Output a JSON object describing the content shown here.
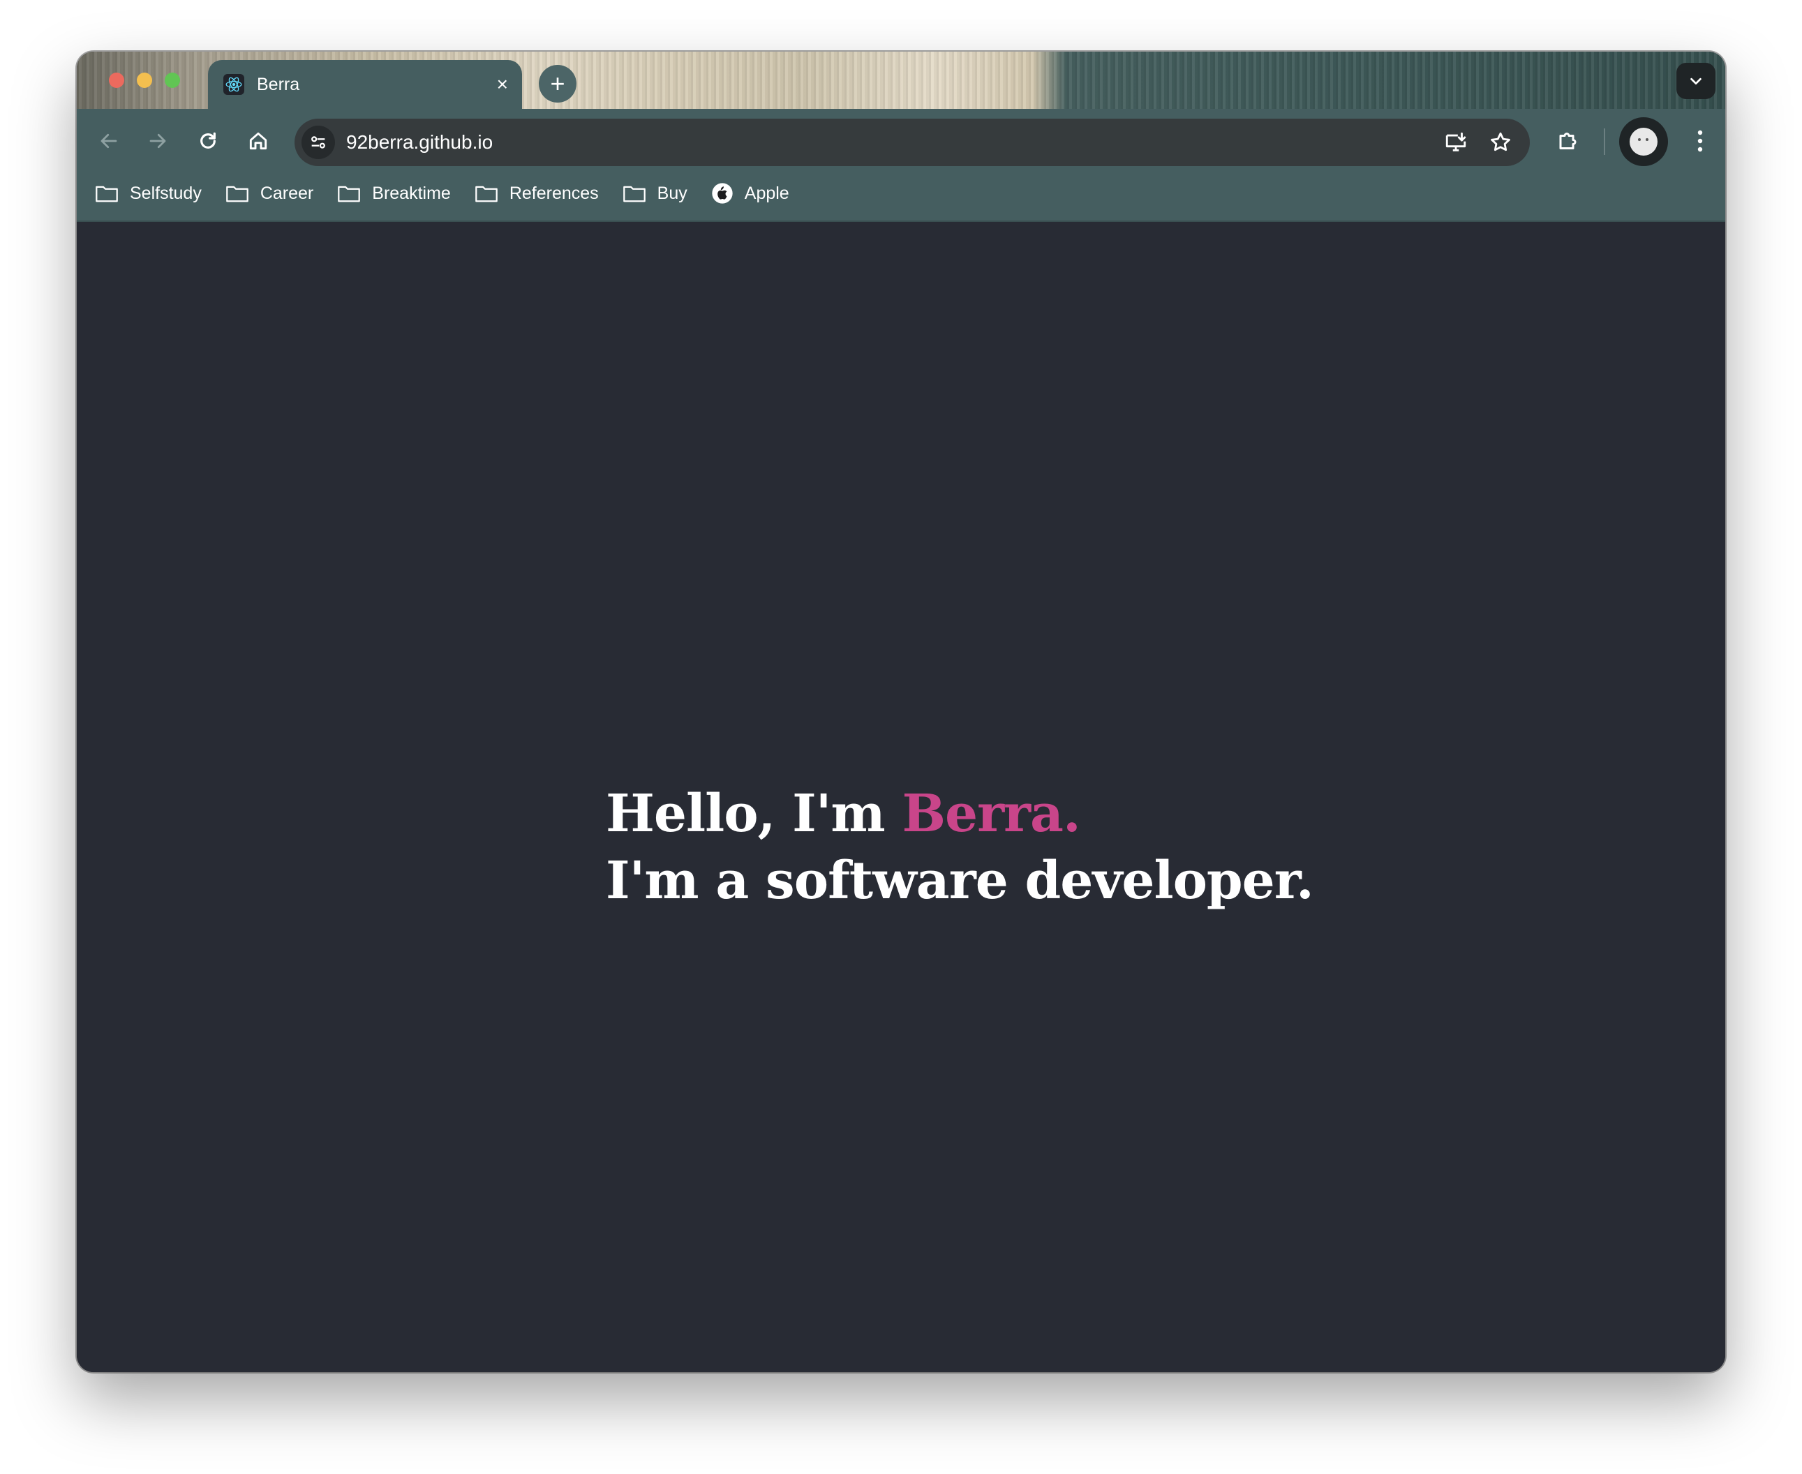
{
  "browser": {
    "tab": {
      "title": "Berra",
      "close": "×"
    },
    "new_tab": "+",
    "address": {
      "url": "92berra.github.io"
    },
    "bookmarks": [
      {
        "label": "Selfstudy",
        "icon": "folder-icon"
      },
      {
        "label": "Career",
        "icon": "folder-icon"
      },
      {
        "label": "Breaktime",
        "icon": "folder-icon"
      },
      {
        "label": "References",
        "icon": "folder-icon"
      },
      {
        "label": "Buy",
        "icon": "folder-icon"
      },
      {
        "label": "Apple",
        "icon": "apple-icon"
      }
    ]
  },
  "page": {
    "greeting": "Hello, I'm ",
    "name": "Berra.",
    "tagline": "I'm a software developer."
  },
  "colors": {
    "accent": "#c9458a",
    "background": "#282b34",
    "chrome": "#455e60"
  }
}
